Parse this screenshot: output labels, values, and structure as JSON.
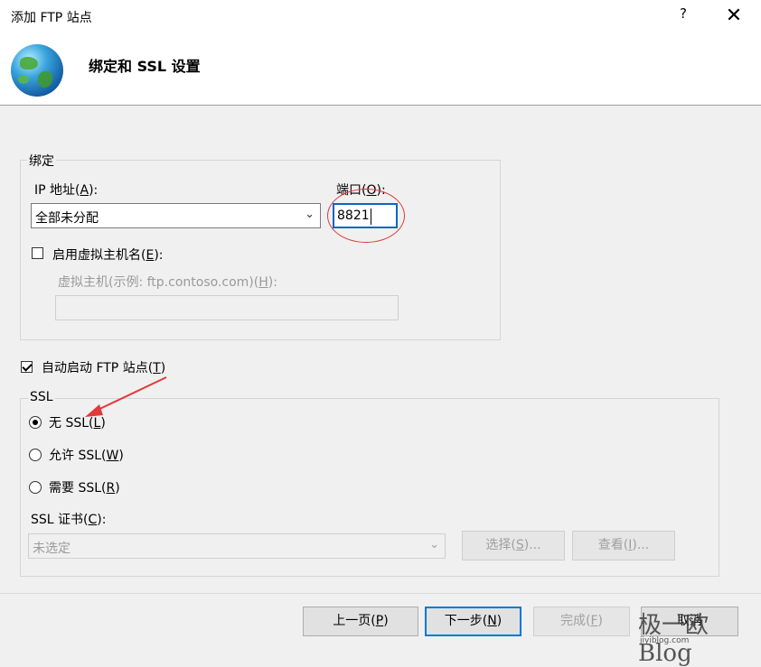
{
  "window": {
    "title": "添加 FTP 站点",
    "help_label": "?",
    "close_label": "✕"
  },
  "header": {
    "title": "绑定和 SSL 设置",
    "icon": "globe-icon"
  },
  "binding": {
    "group_label": "绑定",
    "ip_label": "IP 地址(",
    "ip_key": "A",
    "ip_label_end": "):",
    "ip_value": "全部未分配",
    "port_label": "端口(",
    "port_key": "O",
    "port_label_end": "):",
    "port_value": "8821",
    "virtual_host_checkbox_label": "启用虚拟主机名(",
    "virtual_host_checkbox_key": "E",
    "virtual_host_checkbox_end": "):",
    "virtual_host_checked": false,
    "virtual_host_label": "虚拟主机(示例: ftp.contoso.com)(",
    "virtual_host_key": "H",
    "virtual_host_end": "):",
    "virtual_host_value": ""
  },
  "autostart": {
    "label": "自动启动 FTP 站点(",
    "key": "T",
    "label_end": ")",
    "checked": true
  },
  "ssl": {
    "group_label": "SSL",
    "options": [
      {
        "label": "无 SSL(",
        "key": "L",
        "end": ")",
        "selected": true
      },
      {
        "label": "允许 SSL(",
        "key": "W",
        "end": ")",
        "selected": false
      },
      {
        "label": "需要 SSL(",
        "key": "R",
        "end": ")",
        "selected": false
      }
    ],
    "cert_label": "SSL 证书(",
    "cert_key": "C",
    "cert_label_end": "):",
    "cert_value": "未选定",
    "select_button": {
      "label": "选择(",
      "key": "S",
      "end": ")..."
    },
    "view_button": {
      "label": "查看(",
      "key": "I",
      "end": ")..."
    }
  },
  "footer": {
    "prev": {
      "label": "上一页(",
      "key": "P",
      "end": ")"
    },
    "next": {
      "label": "下一步(",
      "key": "N",
      "end": ")"
    },
    "finish": {
      "label": "完成(",
      "key": "F",
      "end": ")"
    },
    "cancel_partial": "取消"
  },
  "watermark": {
    "text": "极一欧Blog",
    "url": "jiyiblog.com"
  },
  "colors": {
    "annotation_red": "#e03a3a",
    "focus_blue": "#0078d7"
  }
}
